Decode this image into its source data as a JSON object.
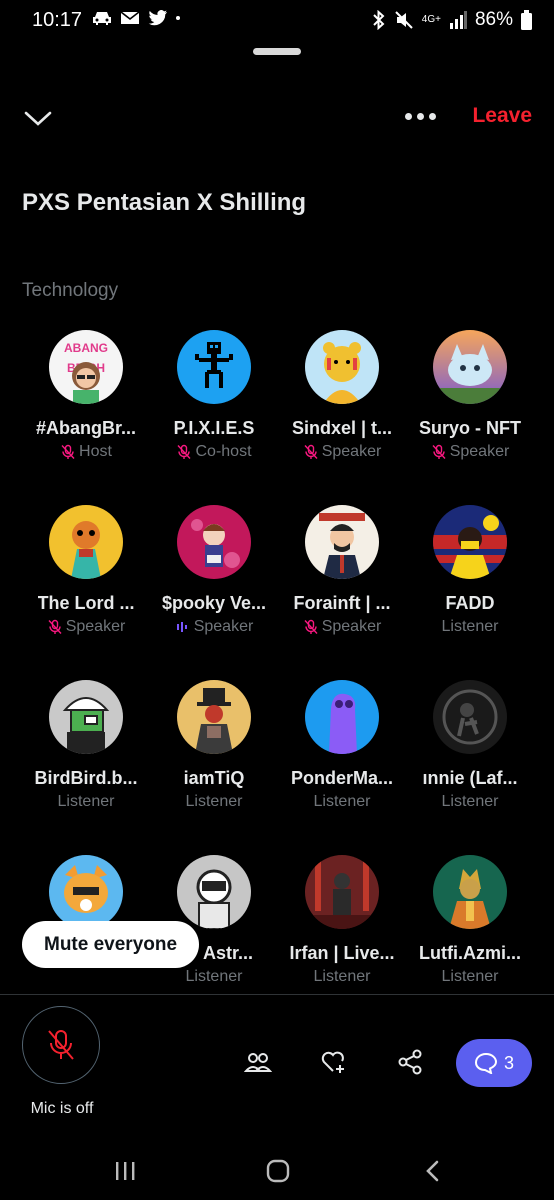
{
  "status_bar": {
    "time": "10:17",
    "battery": "86%",
    "network": "4G+"
  },
  "space": {
    "title": "PXS Pentasian X Shilling",
    "topic": "Technology"
  },
  "header": {
    "leave_label": "Leave"
  },
  "participants": [
    [
      {
        "name": "#AbangBr...",
        "role": "Host",
        "role_icon": "mic-off-icon",
        "avatar_text": "ABANG BRANCH"
      },
      {
        "name": "P.I.X.I.E.S",
        "role": "Co-host",
        "role_icon": "mic-off-icon"
      },
      {
        "name": "Sindxel | t...",
        "role": "Speaker",
        "role_icon": "mic-off-icon"
      },
      {
        "name": "Suryo - NFT",
        "role": "Speaker",
        "role_icon": "mic-off-icon"
      }
    ],
    [
      {
        "name": "The Lord ...",
        "role": "Speaker",
        "role_icon": "mic-off-icon"
      },
      {
        "name": "$pooky Ve...",
        "role": "Speaker",
        "role_icon": "speaking-bars-icon"
      },
      {
        "name": "Forainft | ...",
        "role": "Speaker",
        "role_icon": "mic-off-icon"
      },
      {
        "name": "FADD",
        "role": "Listener",
        "role_icon": ""
      }
    ],
    [
      {
        "name": "BirdBird.b...",
        "role": "Listener",
        "role_icon": ""
      },
      {
        "name": "iamTiQ",
        "role": "Listener",
        "role_icon": ""
      },
      {
        "name": "PonderMa...",
        "role": "Listener",
        "role_icon": ""
      },
      {
        "name": "ınnie (Laf...",
        "role": "Listener",
        "role_icon": ""
      }
    ],
    [
      {
        "name": "",
        "role": "Listener",
        "role_icon": ""
      },
      {
        "name": "Astr...",
        "role": "Listener",
        "role_icon": ""
      },
      {
        "name": "Irfan | Live...",
        "role": "Listener",
        "role_icon": ""
      },
      {
        "name": "Lutfi.Azmi...",
        "role": "Listener",
        "role_icon": ""
      }
    ]
  ],
  "toast": {
    "label": "Mute everyone"
  },
  "bottom": {
    "mic_label": "Mic is off",
    "comments_count": "3"
  },
  "colors": {
    "leave": "#f4212e",
    "accent": "#5b5fef",
    "muted_mic": "#f91880",
    "speaking": "#7856ff"
  }
}
